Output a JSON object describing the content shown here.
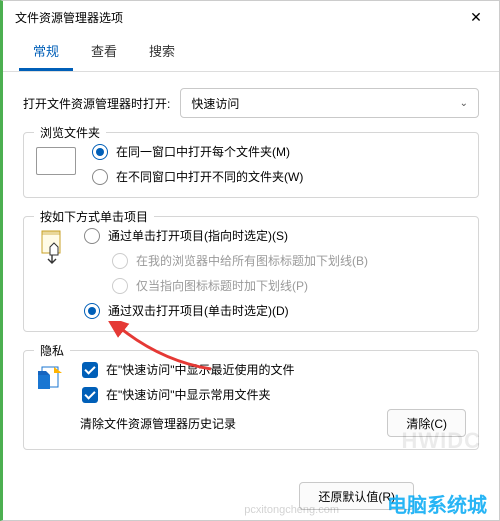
{
  "window": {
    "title": "文件资源管理器选项"
  },
  "tabs": {
    "general": "常规",
    "view": "查看",
    "search": "搜索"
  },
  "open_in": {
    "label": "打开文件资源管理器时打开:",
    "value": "快速访问"
  },
  "browse_folders": {
    "title": "浏览文件夹",
    "same_window": "在同一窗口中打开每个文件夹(M)",
    "new_window": "在不同窗口中打开不同的文件夹(W)"
  },
  "click_items": {
    "title": "按如下方式单击项目",
    "single_click": "通过单击打开项目(指向时选定)(S)",
    "underline_browser": "在我的浏览器中给所有图标标题加下划线(B)",
    "underline_point": "仅当指向图标标题时加下划线(P)",
    "double_click": "通过双击打开项目(单击时选定)(D)"
  },
  "privacy": {
    "title": "隐私",
    "recent_files": "在\"快速访问\"中显示最近使用的文件",
    "frequent_folders": "在\"快速访问\"中显示常用文件夹",
    "clear_label": "清除文件资源管理器历史记录",
    "clear_button": "清除(C)"
  },
  "footer": {
    "restore": "还原默认值(R)"
  },
  "watermarks": {
    "wm1": "HWIDC",
    "wm2": "电脑系统城",
    "wm3": "pcxitongcheng.com"
  }
}
